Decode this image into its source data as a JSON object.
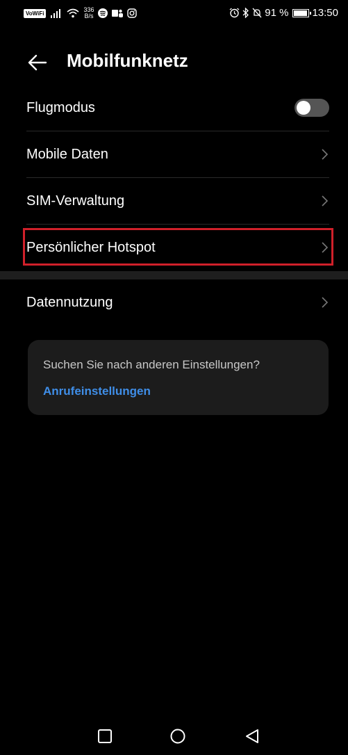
{
  "statusbar": {
    "vowifi": "VoWiFi",
    "speed_value": "336",
    "speed_unit": "B/s",
    "battery_percent": "91 %",
    "battery_level": 0.91,
    "time": "13:50"
  },
  "header": {
    "title": "Mobilfunknetz"
  },
  "rows": [
    {
      "label": "Flugmodus",
      "control": "toggle",
      "toggle_on": false
    },
    {
      "label": "Mobile Daten",
      "control": "chevron"
    },
    {
      "label": "SIM-Verwaltung",
      "control": "chevron"
    },
    {
      "label": "Persönlicher Hotspot",
      "control": "chevron",
      "highlighted": true
    },
    {
      "label": "Datennutzung",
      "control": "chevron"
    }
  ],
  "suggestion": {
    "question": "Suchen Sie nach anderen Einstellungen?",
    "link": "Anrufeinstellungen"
  },
  "colors": {
    "accent_link": "#3f8ee8",
    "highlight_border": "#d0202a"
  },
  "navbar": {
    "icons": [
      "square-icon",
      "circle-icon",
      "triangle-back-icon"
    ]
  }
}
